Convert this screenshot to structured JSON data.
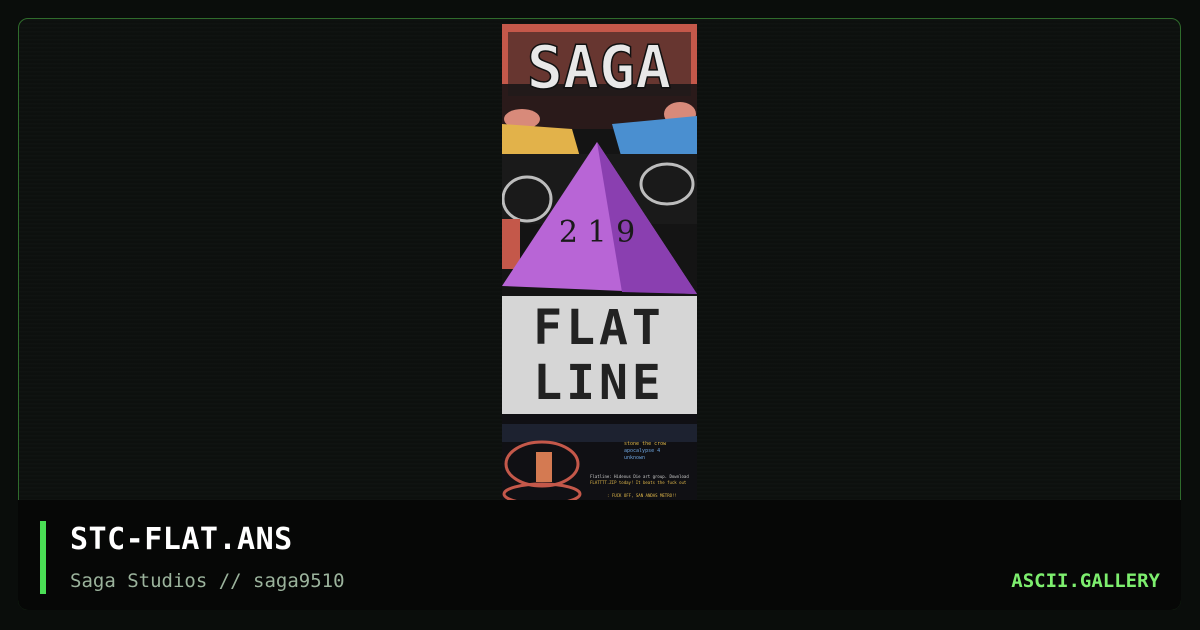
{
  "artwork": {
    "logo_text": "SAGA",
    "headline_line1": "FLAT",
    "headline_line2": "LINE",
    "pyramid_text": "2 1 9",
    "credits_line1": "stone the crow",
    "credits_line2": "apocalypse 4",
    "credits_line3": "unknown",
    "footer_lines": [
      "Flatline: Hideous Die art group. Download",
      "FLATTTT.ZIP today! It beats the fuck out",
      ": FUCK OFF, SAN ANDAS METRO!!"
    ]
  },
  "footer": {
    "title": "STC-FLAT.ANS",
    "subtitle": "Saga Studios // saga9510",
    "brand": "ASCII.GALLERY"
  },
  "colors": {
    "accent": "#4ade55",
    "brand": "#7dee6e",
    "border": "#2f6b2c"
  }
}
